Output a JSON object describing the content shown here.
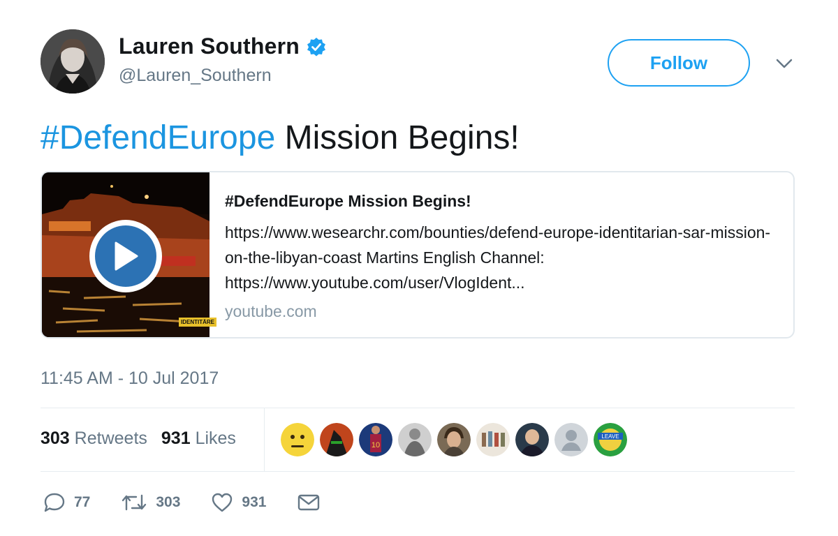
{
  "author": {
    "name": "Lauren Southern",
    "handle": "@Lauren_Southern",
    "verified_icon": "verified-badge-icon",
    "avatar": "profile-photo"
  },
  "follow_label": "Follow",
  "tweet": {
    "hashtag": "#DefendEurope",
    "text_rest": " Mission Begins!"
  },
  "card": {
    "title": "#DefendEurope Mission Begins!",
    "description": "https://www.wesearchr.com/bounties/defend-europe-identitarian-sar-mission-on-the-libyan-coast Martins English Channel: https://www.youtube.com/user/VlogIdent...",
    "domain": "youtube.com",
    "badge": "IDENTITÄRE"
  },
  "timestamp": "11:45 AM - 10 Jul 2017",
  "stats": {
    "retweets_count": "303",
    "retweets_label": "Retweets",
    "likes_count": "931",
    "likes_label": "Likes"
  },
  "actions": {
    "reply_count": "77",
    "retweet_count": "303",
    "like_count": "931"
  },
  "colors": {
    "accent": "#1da1f2",
    "hashtag": "#1b95e0",
    "muted": "#657786",
    "border": "#e1e8ed"
  }
}
